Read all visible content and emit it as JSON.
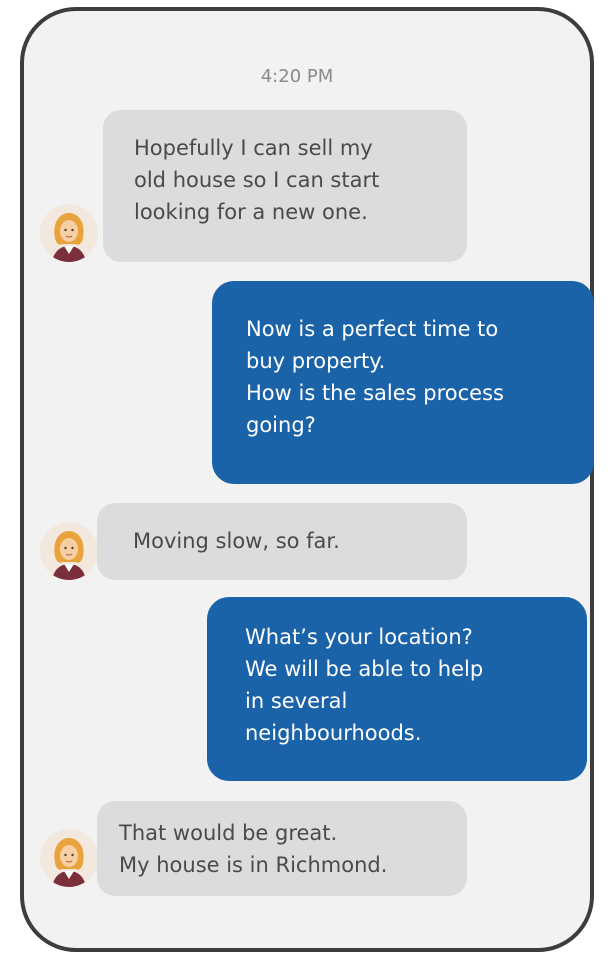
{
  "chat": {
    "timestamp": "4:20 PM",
    "messages": [
      {
        "direction": "incoming",
        "text": "Hopefully I can sell my\nold house so I can start\nlooking for a new one."
      },
      {
        "direction": "outgoing",
        "text": "Now is a perfect time to\nbuy property.\nHow is the sales process\ngoing?"
      },
      {
        "direction": "incoming",
        "text": "Moving slow, so far."
      },
      {
        "direction": "outgoing",
        "text": "What’s your location?\nWe will be able to help\nin several\nneighbourhoods."
      },
      {
        "direction": "incoming",
        "text": "That would be great.\nMy house is in Richmond."
      }
    ]
  },
  "avatar": {
    "icon": "woman-avatar-icon"
  },
  "colors": {
    "incoming_bubble": "#dcdcdc",
    "outgoing_bubble": "#1b63a8",
    "background": "#f2f2f2",
    "frame": "#3d3d3d"
  }
}
